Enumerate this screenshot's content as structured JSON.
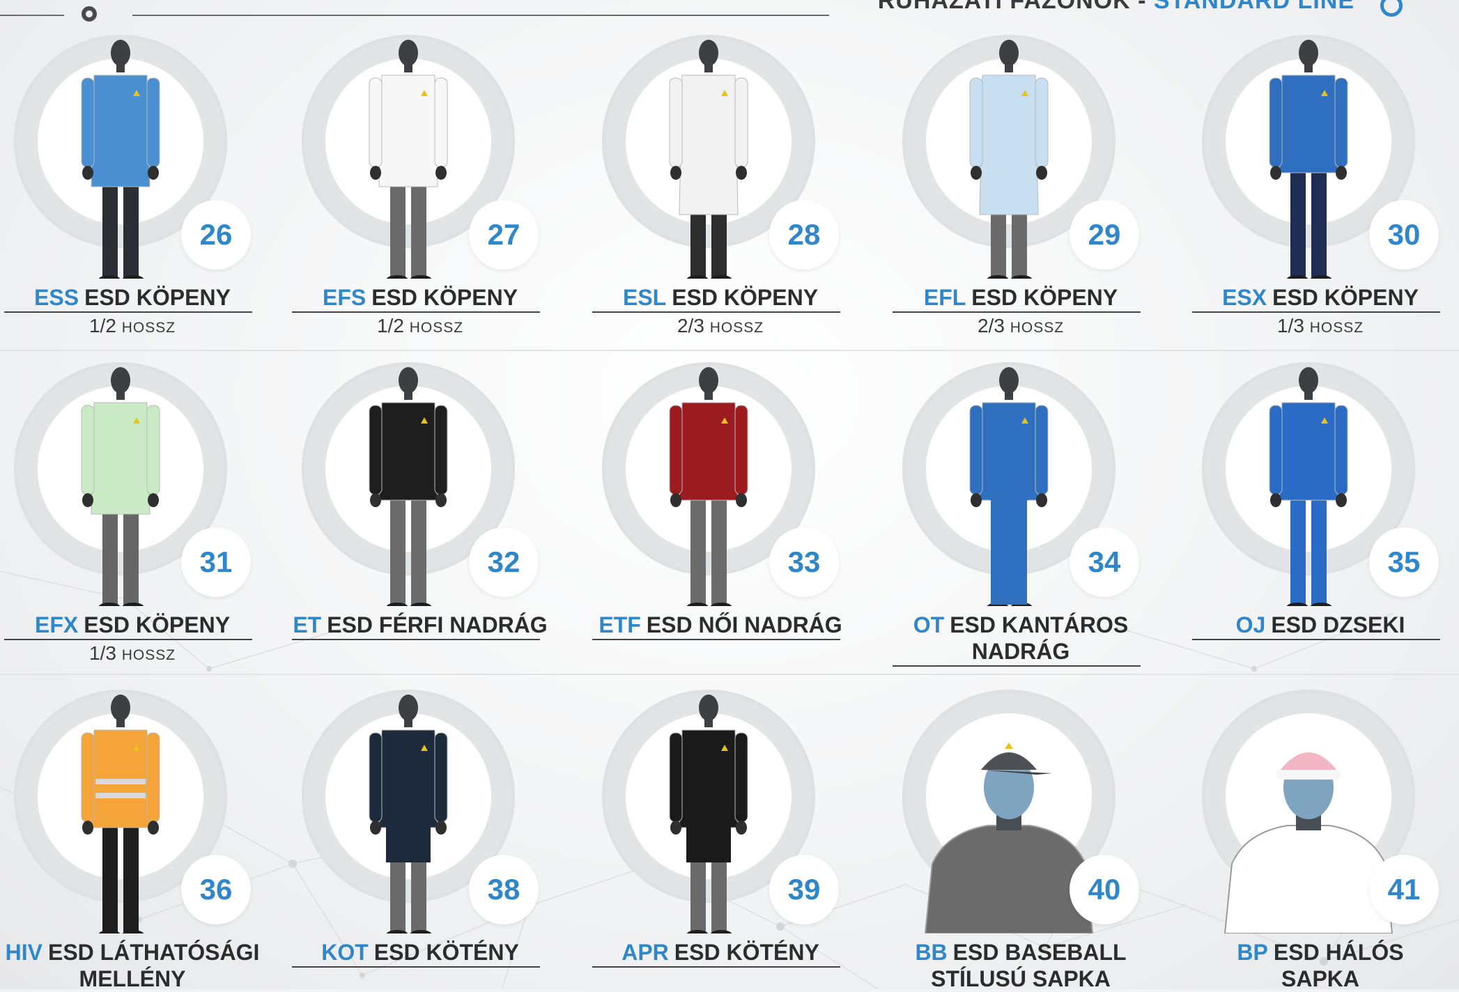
{
  "header": {
    "title_prefix": "RUHÁZATI FAZONOK - ",
    "title_accent": "STANDARD LINE"
  },
  "colors": {
    "accent": "#2f86c8",
    "text": "#2c2c2c",
    "background": "#f1f2f3"
  },
  "products": [
    {
      "code": "ESS",
      "name": "ESD KÖPENY",
      "number": "26",
      "length_value": "1/2",
      "length_unit": "HOSSZ",
      "icon": "blue-lab-coat-mannequin",
      "shirt": "#4a8fd0",
      "pants": "#2b2f35"
    },
    {
      "code": "EFS",
      "name": "ESD KÖPENY",
      "number": "27",
      "length_value": "1/2",
      "length_unit": "HOSSZ",
      "icon": "white-lab-coat-mannequin",
      "shirt": "#f7f7f7",
      "pants": "#6a6a6a"
    },
    {
      "code": "ESL",
      "name": "ESD KÖPENY",
      "number": "28",
      "length_value": "2/3",
      "length_unit": "HOSSZ",
      "icon": "white-long-coat-mannequin",
      "shirt": "#f2f2f2",
      "pants": "#2d2d2d"
    },
    {
      "code": "EFL",
      "name": "ESD KÖPENY",
      "number": "29",
      "length_value": "2/3",
      "length_unit": "HOSSZ",
      "icon": "light-blue-coat-mannequin",
      "shirt": "#c8dff2",
      "pants": "#6a6a6a"
    },
    {
      "code": "ESX",
      "name": "ESD KÖPENY",
      "number": "30",
      "length_value": "1/3",
      "length_unit": "HOSSZ",
      "icon": "blue-jacket-mannequin",
      "shirt": "#2f6fc0",
      "pants": "#1f2d55"
    },
    {
      "code": "EFX",
      "name": "ESD KÖPENY",
      "number": "31",
      "length_value": "1/3",
      "length_unit": "HOSSZ",
      "icon": "green-coat-mannequin",
      "shirt": "#c9eac4",
      "pants": "#666666"
    },
    {
      "code": "ET",
      "name": "ESD FÉRFI NADRÁG",
      "number": "32",
      "icon": "mens-trousers-mannequin",
      "shirt": "#1e1e1e",
      "pants": "#6c6c6c"
    },
    {
      "code": "ETF",
      "name": "ESD NŐI NADRÁG",
      "number": "33",
      "icon": "womens-trousers-mannequin",
      "shirt": "#9b1b1f",
      "pants": "#6c6c6c"
    },
    {
      "code": "OT",
      "name": "ESD KANTÁROS",
      "name2": "NADRÁG",
      "number": "34",
      "icon": "bib-overalls-mannequin",
      "shirt": "#2f6fc0",
      "pants": "#2f6fc0"
    },
    {
      "code": "OJ",
      "name": "ESD DZSEKI",
      "number": "35",
      "icon": "blue-workwear-mannequin",
      "shirt": "#2a6bc5",
      "pants": "#2a6bc5"
    },
    {
      "code": "HIV",
      "name": "ESD LÁTHATÓSÁGI",
      "name2": "MELLÉNY",
      "number": "36",
      "icon": "hi-vis-vest-mannequin",
      "shirt": "#f5a43a",
      "pants": "#1e1e1e"
    },
    {
      "code": "KOT",
      "name": "ESD KÖTÉNY",
      "number": "38",
      "icon": "tabard-apron-mannequin",
      "shirt": "#1c2a3c",
      "pants": "#6a6a6a"
    },
    {
      "code": "APR",
      "name": "ESD KÖTÉNY",
      "number": "39",
      "icon": "black-apron-mannequin",
      "shirt": "#1a1a1a",
      "pants": "#6a6a6a"
    },
    {
      "code": "BB",
      "name": "ESD BASEBALL",
      "name2": "STÍLUSÚ SAPKA",
      "number": "40",
      "icon": "baseball-cap-mannequin",
      "shirt": "#6b6b6b",
      "pants": "#6b6b6b"
    },
    {
      "code": "BP",
      "name": "ESD HÁLÓS",
      "name2": "SAPKA",
      "number": "41",
      "icon": "mesh-cap-mannequin",
      "shirt": "#ffffff",
      "pants": "#ffffff"
    }
  ]
}
